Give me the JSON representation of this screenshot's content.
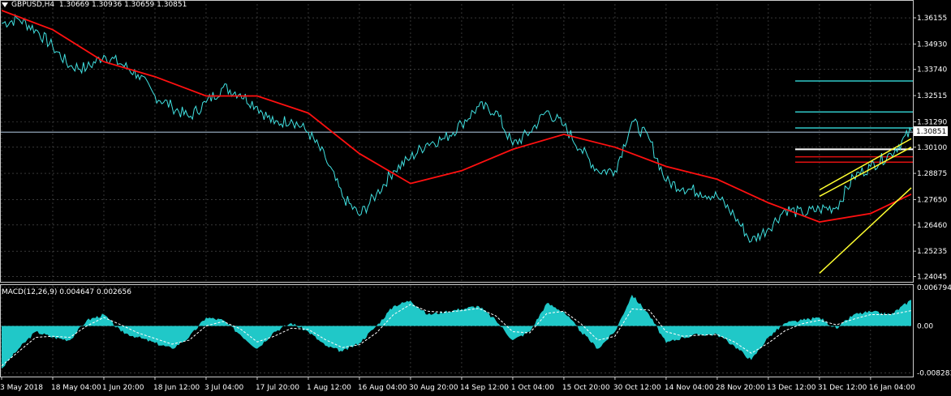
{
  "header": {
    "symbol": "GBPUSD,H4",
    "ohlc": "1.30669 1.30936 1.30659 1.30851"
  },
  "macd_header": {
    "label": "MACD(12,26,9) 0.004647 0.002656"
  },
  "colors": {
    "background": "#000000",
    "grid": "#5a5a5a",
    "price": "#40e0e0",
    "ma": "#ff1010",
    "macd_hist": "#20c8c8",
    "signal": "#ffffff",
    "channel": "#ffff30",
    "level_white": "#ffffff",
    "level_red": "#e01010",
    "level_cyan": "#30c8c8"
  },
  "chart_data": [
    {
      "type": "line",
      "title": "GBPUSD,H4",
      "ylim": [
        1.238,
        1.368
      ],
      "y_ticks": [
        "1.36155",
        "1.34930",
        "1.33740",
        "1.32515",
        "1.31290",
        "1.30100",
        "1.28875",
        "1.27650",
        "1.26460",
        "1.25235",
        "1.24045"
      ],
      "current_price": "1.30851",
      "x_ticks": [
        "3 May 2018",
        "18 May 04:00",
        "1 Jun 20:00",
        "18 Jun 12:00",
        "3 Jul 04:00",
        "17 Jul 20:00",
        "1 Aug 12:00",
        "16 Aug 04:00",
        "30 Aug 20:00",
        "14 Sep 12:00",
        "1 Oct 04:00",
        "15 Oct 20:00",
        "30 Oct 12:00",
        "14 Nov 04:00",
        "28 Nov 20:00",
        "13 Dec 12:00",
        "31 Dec 12:00",
        "16 Jan 04:00"
      ],
      "series": [
        {
          "role": "close",
          "x": [
            "3 May 2018",
            "8 May",
            "12 May",
            "18 May 04:00",
            "22 May",
            "27 May",
            "1 Jun 20:00",
            "6 Jun",
            "11 Jun",
            "18 Jun 12:00",
            "22 Jun",
            "27 Jun",
            "3 Jul 04:00",
            "7 Jul",
            "12 Jul",
            "17 Jul 20:00",
            "21 Jul",
            "26 Jul",
            "1 Aug 12:00",
            "6 Aug",
            "11 Aug",
            "16 Aug 04:00",
            "20 Aug",
            "25 Aug",
            "30 Aug 20:00",
            "4 Sep",
            "9 Sep",
            "14 Sep 12:00",
            "18 Sep",
            "24 Sep",
            "1 Oct 04:00",
            "5 Oct",
            "10 Oct",
            "15 Oct 20:00",
            "20 Oct",
            "25 Oct",
            "30 Oct 12:00",
            "3 Nov",
            "8 Nov",
            "14 Nov 04:00",
            "18 Nov",
            "23 Nov",
            "28 Nov 20:00",
            "3 Dec",
            "8 Dec",
            "13 Dec 12:00",
            "19 Dec",
            "25 Dec",
            "31 Dec 12:00",
            "5 Jan",
            "11 Jan",
            "16 Jan 04:00",
            "20 Jan",
            "22 Jan"
          ],
          "values": [
            1.359,
            1.361,
            1.356,
            1.348,
            1.339,
            1.338,
            1.344,
            1.34,
            1.335,
            1.325,
            1.32,
            1.315,
            1.322,
            1.329,
            1.326,
            1.32,
            1.312,
            1.314,
            1.308,
            1.296,
            1.278,
            1.269,
            1.279,
            1.29,
            1.296,
            1.303,
            1.305,
            1.312,
            1.32,
            1.318,
            1.302,
            1.308,
            1.318,
            1.311,
            1.3,
            1.29,
            1.29,
            1.313,
            1.305,
            1.285,
            1.282,
            1.28,
            1.278,
            1.269,
            1.257,
            1.263,
            1.272,
            1.27,
            1.272,
            1.273,
            1.287,
            1.292,
            1.298,
            1.3085
          ]
        },
        {
          "role": "moving_average",
          "x": [
            "3 May 2018",
            "18 May 04:00",
            "1 Jun 20:00",
            "18 Jun 12:00",
            "3 Jul 04:00",
            "17 Jul 20:00",
            "1 Aug 12:00",
            "16 Aug 04:00",
            "30 Aug 20:00",
            "14 Sep 12:00",
            "1 Oct 04:00",
            "15 Oct 20:00",
            "30 Oct 12:00",
            "14 Nov 04:00",
            "28 Nov 20:00",
            "13 Dec 12:00",
            "31 Dec 12:00",
            "16 Jan 04:00",
            "22 Jan"
          ],
          "values": [
            1.365,
            1.356,
            1.341,
            1.334,
            1.325,
            1.325,
            1.317,
            1.298,
            1.284,
            1.29,
            1.3,
            1.307,
            1.301,
            1.292,
            1.286,
            1.275,
            1.266,
            1.27,
            1.279
          ]
        }
      ],
      "horizontal_levels": [
        {
          "value": 1.332,
          "color": "cyan"
        },
        {
          "value": 1.3175,
          "color": "cyan"
        },
        {
          "value": 1.31,
          "color": "cyan"
        },
        {
          "value": 1.308,
          "color": "grey"
        },
        {
          "value": 1.3,
          "color": "white"
        },
        {
          "value": 1.2965,
          "color": "red"
        },
        {
          "value": 1.294,
          "color": "red"
        }
      ],
      "channel_lines": [
        {
          "from": [
            "31 Dec 12:00",
            1.281
          ],
          "to": [
            "22 Jan",
            1.305
          ]
        },
        {
          "from": [
            "31 Dec 12:00",
            1.278
          ],
          "to": [
            "22 Jan",
            1.301
          ]
        },
        {
          "from": [
            "31 Dec 12:00",
            1.242
          ],
          "to": [
            "22 Jan",
            1.282
          ]
        }
      ]
    },
    {
      "type": "bar",
      "title": "MACD(12,26,9) 0.004647 0.002656",
      "ylim": [
        -0.0089,
        0.0072
      ],
      "y_ticks": [
        "0.006794",
        "0.00",
        "-0.008283"
      ],
      "x": [
        "3 May 2018",
        "8 May",
        "12 May",
        "18 May 04:00",
        "22 May",
        "27 May",
        "1 Jun 20:00",
        "6 Jun",
        "11 Jun",
        "18 Jun 12:00",
        "22 Jun",
        "27 Jun",
        "3 Jul 04:00",
        "7 Jul",
        "12 Jul",
        "17 Jul 20:00",
        "21 Jul",
        "26 Jul",
        "1 Aug 12:00",
        "6 Aug",
        "11 Aug",
        "16 Aug 04:00",
        "20 Aug",
        "25 Aug",
        "30 Aug 20:00",
        "4 Sep",
        "9 Sep",
        "14 Sep 12:00",
        "18 Sep",
        "24 Sep",
        "1 Oct 04:00",
        "5 Oct",
        "10 Oct",
        "15 Oct 20:00",
        "20 Oct",
        "25 Oct",
        "30 Oct 12:00",
        "3 Nov",
        "8 Nov",
        "14 Nov 04:00",
        "18 Nov",
        "23 Nov",
        "28 Nov 20:00",
        "3 Dec",
        "8 Dec",
        "13 Dec 12:00",
        "19 Dec",
        "25 Dec",
        "31 Dec 12:00",
        "5 Jan",
        "11 Jan",
        "16 Jan 04:00",
        "20 Jan",
        "22 Jan"
      ],
      "series": [
        {
          "role": "macd",
          "values": [
            -0.0075,
            -0.004,
            -0.001,
            -0.002,
            -0.0025,
            0.001,
            0.002,
            -0.001,
            -0.002,
            -0.003,
            -0.004,
            -0.002,
            0.0015,
            0.001,
            -0.0015,
            -0.004,
            -0.001,
            0.0005,
            -0.001,
            -0.0035,
            -0.0045,
            -0.003,
            0.0,
            0.0035,
            0.0045,
            0.002,
            0.0025,
            0.003,
            0.0035,
            0.001,
            -0.0025,
            -0.001,
            0.004,
            0.0025,
            -0.001,
            -0.004,
            -0.001,
            0.0055,
            0.002,
            -0.003,
            -0.002,
            -0.0015,
            -0.0015,
            -0.0035,
            -0.006,
            -0.002,
            0.0005,
            0.001,
            0.0015,
            -0.0005,
            0.002,
            0.0025,
            0.002,
            0.0046
          ]
        },
        {
          "role": "signal",
          "values": [
            -0.007,
            -0.0045,
            -0.002,
            -0.0018,
            -0.002,
            0.0,
            0.0015,
            0.0002,
            -0.0012,
            -0.0022,
            -0.0032,
            -0.0025,
            0.0,
            0.0008,
            -0.0005,
            -0.0028,
            -0.0018,
            -0.0004,
            -0.0006,
            -0.0024,
            -0.0038,
            -0.0033,
            -0.0012,
            0.002,
            0.0038,
            0.0026,
            0.0024,
            0.0027,
            0.0031,
            0.0018,
            -0.001,
            -0.0012,
            0.0022,
            0.0026,
            0.0004,
            -0.0025,
            -0.0018,
            0.003,
            0.0028,
            -0.001,
            -0.0018,
            -0.0016,
            -0.0015,
            -0.0028,
            -0.0048,
            -0.003,
            -0.0008,
            0.0004,
            0.001,
            0.0002,
            0.0012,
            0.002,
            0.002,
            0.0027
          ]
        }
      ]
    }
  ]
}
